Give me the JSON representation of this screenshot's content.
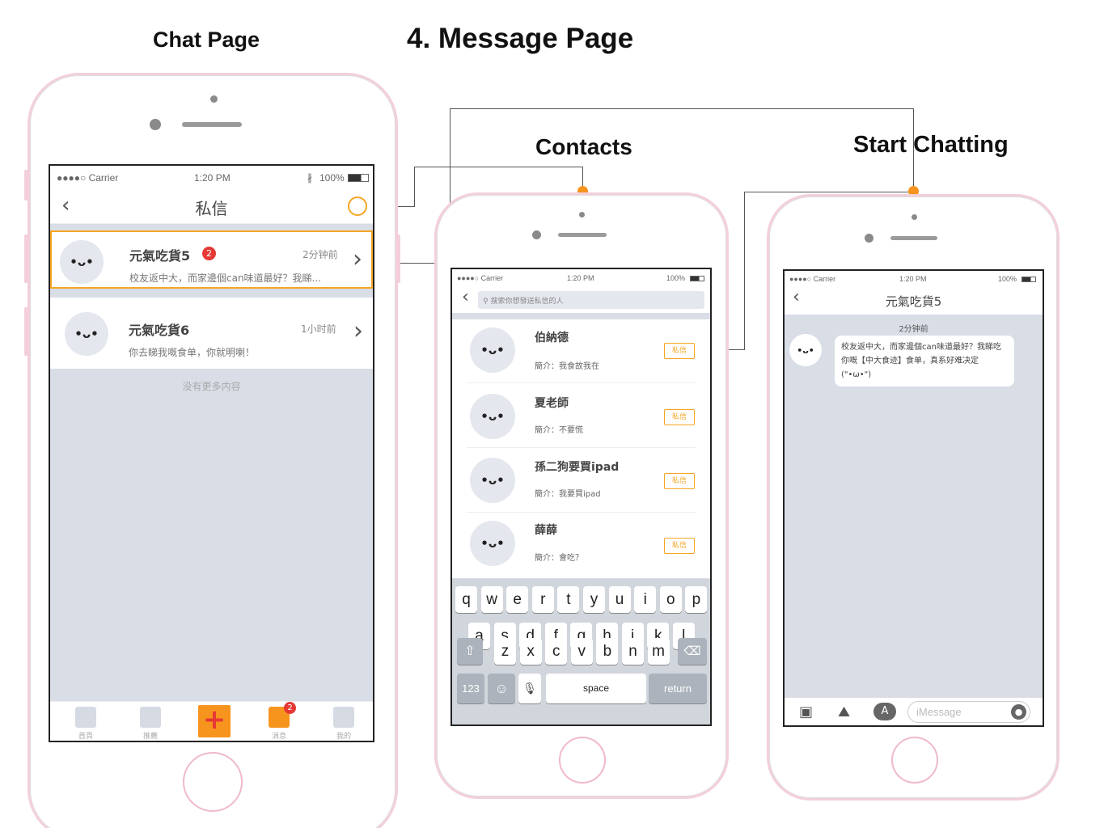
{
  "headings": {
    "chat_page": "Chat Page",
    "message_page": "4. Message Page",
    "contacts": "Contacts",
    "start_chatting": "Start Chatting"
  },
  "status": {
    "carrier": "●●●●○ Carrier",
    "time": "1:20 PM",
    "battery": "100%"
  },
  "chat_page": {
    "title": "私信",
    "items": [
      {
        "name": "元氣吃貨5",
        "badge": "2",
        "time": "2分钟前",
        "preview": "校友返中大，而家邊個can味道最好？我睇..."
      },
      {
        "name": "元氣吃貨6",
        "time": "1小时前",
        "preview": "你去睇我嘅食单，你就明喇！"
      }
    ],
    "no_more": "没有更多内容",
    "tabs": [
      "首頁",
      "推薦",
      "",
      "消息",
      "我的"
    ],
    "tab_badge": "2"
  },
  "contacts_page": {
    "search_placeholder": "搜索你想發送私信的人",
    "contacts": [
      {
        "name": "伯納德",
        "intro": "簡介：我食故我在",
        "button": "私信"
      },
      {
        "name": "夏老師",
        "intro": "簡介：不要慌",
        "button": "私信"
      },
      {
        "name": "孫二狗要買ipad",
        "intro": "簡介：我要買ipad",
        "button": "私信"
      },
      {
        "name": "薛薛",
        "intro": "簡介：會吃？",
        "button": "私信"
      }
    ],
    "keyboard": {
      "row1": [
        "q",
        "w",
        "e",
        "r",
        "t",
        "y",
        "u",
        "i",
        "o",
        "p"
      ],
      "row2": [
        "a",
        "s",
        "d",
        "f",
        "g",
        "h",
        "j",
        "k",
        "l"
      ],
      "row3": [
        "z",
        "x",
        "c",
        "v",
        "b",
        "n",
        "m"
      ],
      "num": "123",
      "space": "space",
      "return": "return"
    }
  },
  "chatting_page": {
    "title": "元氣吃貨5",
    "timestamp": "2分钟前",
    "message": "校友返中大，而家邊個can味道最好？我睇吃你嘅【中大食迹】食单，真系好难决定(\"•ω•\")",
    "input_placeholder": "iMessage"
  },
  "avatar_face": "•ᴗ•",
  "colors": {
    "accent": "#f7941d",
    "badge": "#e53935",
    "frame": "#f3cfdb",
    "screen_bg": "#d9dde6"
  }
}
